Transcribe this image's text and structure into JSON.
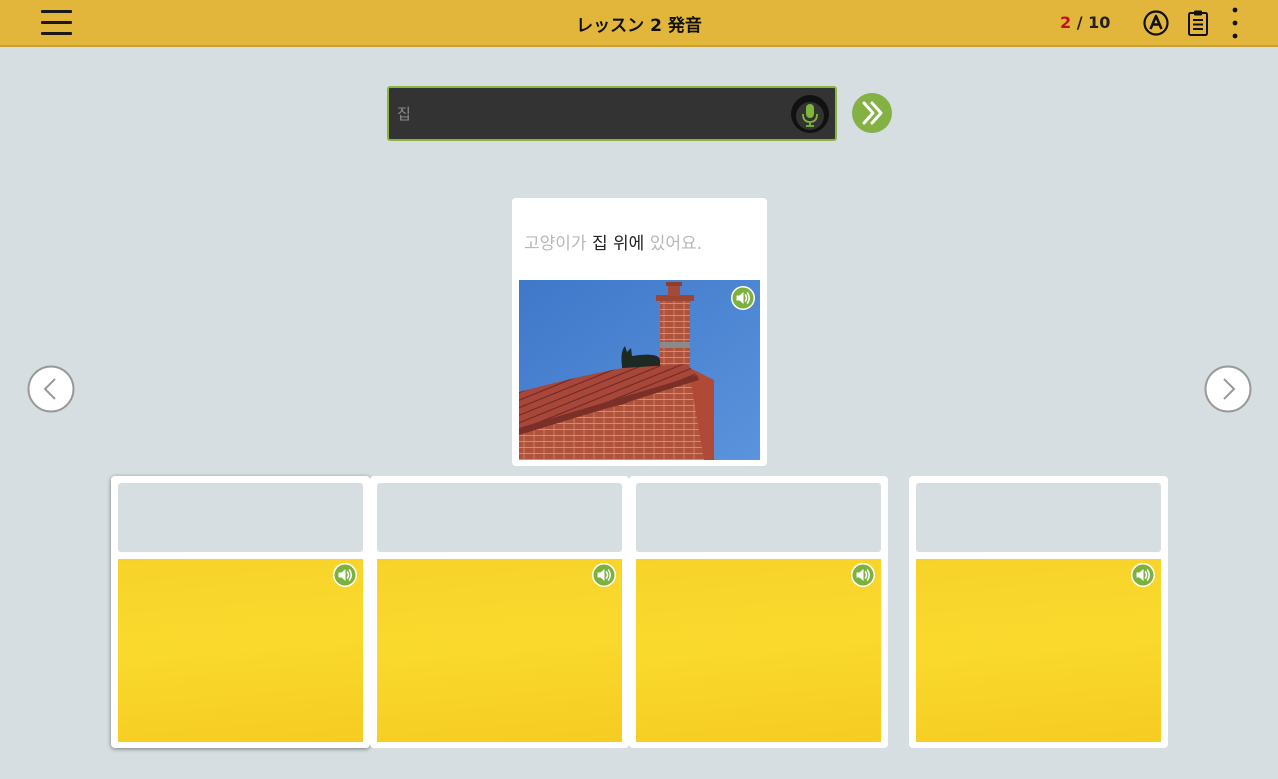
{
  "header": {
    "title": "レッスン 2 発音",
    "progress_current": "2",
    "progress_separator": " / ",
    "progress_total": "10",
    "icons": [
      "menu-icon",
      "answer-key-icon",
      "clipboard-icon",
      "more-vertical-icon"
    ]
  },
  "answer": {
    "placeholder": "집",
    "value": "",
    "icons": [
      "microphone-icon",
      "double-chevron-right-icon"
    ]
  },
  "prompt_card": {
    "sentence_parts": [
      {
        "text": "고양이가 ",
        "highlight": false
      },
      {
        "text": "집 위",
        "highlight": true
      },
      {
        "text": "에",
        "highlight": false
      },
      {
        "text": " 있어요.",
        "highlight": false
      }
    ],
    "image_description_icon": "speaker-icon"
  },
  "choices": [
    {
      "label": "",
      "selected": true
    },
    {
      "label": "",
      "selected": false
    },
    {
      "label": "",
      "selected": false
    },
    {
      "label": "",
      "selected": false
    }
  ],
  "colors": {
    "header_bg": "#e2b53b",
    "page_bg": "#d7dee1",
    "accent_green": "#8bb53f",
    "counter_current": "#c0121f",
    "choice_yellow": "#f8d42b"
  }
}
